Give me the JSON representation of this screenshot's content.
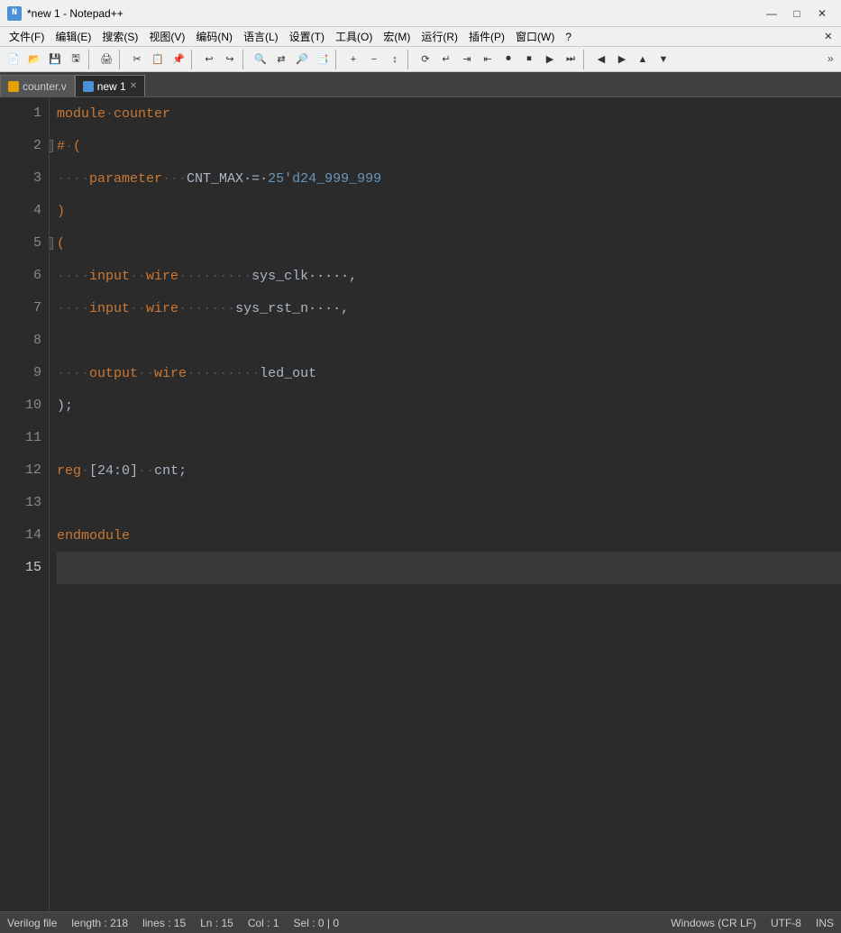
{
  "titleBar": {
    "title": "*new 1 - Notepad++",
    "icon": "N",
    "controls": [
      "—",
      "□",
      "✕"
    ]
  },
  "menuBar": {
    "items": [
      "文件(F)",
      "编辑(E)",
      "搜索(S)",
      "视图(V)",
      "编码(N)",
      "语言(L)",
      "设置(T)",
      "工具(O)",
      "宏(M)",
      "运行(R)",
      "插件(P)",
      "窗口(W)",
      "?"
    ],
    "close": "✕"
  },
  "tabs": [
    {
      "label": "counter.v",
      "icon": "v",
      "active": false,
      "closable": false
    },
    {
      "label": "new 1",
      "icon": "n",
      "active": true,
      "closable": true
    }
  ],
  "code": {
    "lines": [
      {
        "num": 1,
        "tokens": [
          {
            "t": "module",
            "c": "kw-module"
          },
          {
            "t": "·",
            "c": "dot"
          },
          {
            "t": "counter",
            "c": "kw-name"
          }
        ]
      },
      {
        "num": 2,
        "tokens": [
          {
            "t": "#",
            "c": "kw-hash"
          },
          {
            "t": "·",
            "c": "dot"
          },
          {
            "t": "(",
            "c": "kw-paren"
          }
        ],
        "fold": true
      },
      {
        "num": 3,
        "tokens": [
          {
            "t": "····",
            "c": "dot"
          },
          {
            "t": "parameter",
            "c": "kw-param"
          },
          {
            "t": "···",
            "c": "dot"
          },
          {
            "t": "CNT_MAX",
            "c": "ident"
          },
          {
            "t": "·=·",
            "c": "op"
          },
          {
            "t": "25'd24_999_999",
            "c": "num"
          }
        ]
      },
      {
        "num": 4,
        "tokens": [
          {
            "t": ")",
            "c": "kw-paren"
          }
        ]
      },
      {
        "num": 5,
        "tokens": [
          {
            "t": "(",
            "c": "kw-paren"
          }
        ],
        "fold": true
      },
      {
        "num": 6,
        "tokens": [
          {
            "t": "····",
            "c": "dot"
          },
          {
            "t": "input",
            "c": "kw-input"
          },
          {
            "t": "··",
            "c": "dot"
          },
          {
            "t": "wire",
            "c": "kw-wire"
          },
          {
            "t": "·········",
            "c": "dot"
          },
          {
            "t": "sys_clk",
            "c": "ident"
          },
          {
            "t": "·····,",
            "c": "comma"
          }
        ]
      },
      {
        "num": 7,
        "tokens": [
          {
            "t": "····",
            "c": "dot"
          },
          {
            "t": "input",
            "c": "kw-input"
          },
          {
            "t": "··",
            "c": "dot"
          },
          {
            "t": "wire",
            "c": "kw-wire"
          },
          {
            "t": "·······",
            "c": "dot"
          },
          {
            "t": "sys_rst_n",
            "c": "ident"
          },
          {
            "t": "····,",
            "c": "comma"
          }
        ]
      },
      {
        "num": 8,
        "tokens": []
      },
      {
        "num": 9,
        "tokens": [
          {
            "t": "····",
            "c": "dot"
          },
          {
            "t": "output",
            "c": "kw-output"
          },
          {
            "t": "··",
            "c": "dot"
          },
          {
            "t": "wire",
            "c": "kw-wire"
          },
          {
            "t": "·········",
            "c": "dot"
          },
          {
            "t": "led_out",
            "c": "ident"
          }
        ]
      },
      {
        "num": 10,
        "tokens": [
          {
            "t": ");",
            "c": "semi"
          }
        ]
      },
      {
        "num": 11,
        "tokens": []
      },
      {
        "num": 12,
        "tokens": [
          {
            "t": "reg",
            "c": "kw-reg"
          },
          {
            "t": "·",
            "c": "dot"
          },
          {
            "t": "[24:0]",
            "c": "bracket"
          },
          {
            "t": "··",
            "c": "dot"
          },
          {
            "t": "cnt;",
            "c": "ident"
          }
        ]
      },
      {
        "num": 13,
        "tokens": []
      },
      {
        "num": 14,
        "tokens": [
          {
            "t": "endmodule",
            "c": "kw-end"
          }
        ]
      },
      {
        "num": 15,
        "tokens": [],
        "active": true
      }
    ]
  },
  "statusBar": {
    "fileType": "Verilog file",
    "length": "length : 218",
    "lines": "lines : 15",
    "ln": "Ln : 15",
    "col": "Col : 1",
    "sel": "Sel : 0 | 0",
    "lineEnding": "Windows (CR LF)",
    "encoding": "UTF-8",
    "mode": "INS"
  }
}
